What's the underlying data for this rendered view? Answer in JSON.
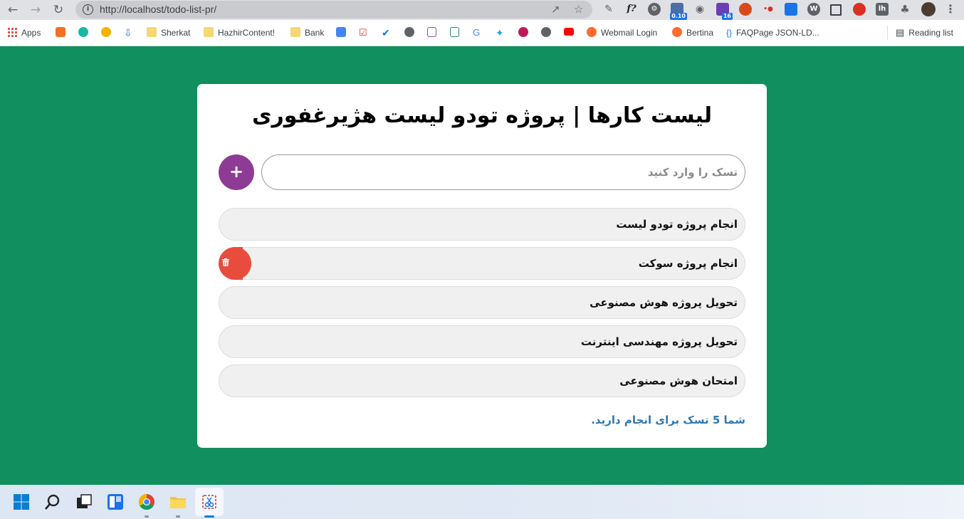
{
  "browser": {
    "url": "http://localhost/todo-list-pr/",
    "bookmarks": [
      {
        "label": "Apps"
      },
      {
        "label": "Sherkat"
      },
      {
        "label": "HazhirContent!"
      },
      {
        "label": "Bank"
      },
      {
        "label": "Webmail Login"
      },
      {
        "label": "Bertina"
      },
      {
        "label": "FAQPage JSON-LD..."
      }
    ],
    "reading_list": "Reading list",
    "extension_badges": {
      "ext_a": "0.10",
      "ext_b": "16"
    }
  },
  "app": {
    "title": "لیست کارها | پروژه تودو لیست هژیرغفوری",
    "input_placeholder": "تسک را وارد کنید",
    "add_button": "+",
    "tasks": [
      {
        "label": "انجام پروژه تودو لیست"
      },
      {
        "label": "انجام پروژه سوکت"
      },
      {
        "label": "تحویل پروژه هوش مصنوعی"
      },
      {
        "label": "تحویل پروژه مهندسی اینترنت"
      },
      {
        "label": "امتحان هوش مصنوعی"
      }
    ],
    "summary": "شما 5 تسک برای انجام دارید."
  },
  "colors": {
    "page_bg": "#118f5e",
    "card_bg": "#ffffff",
    "add_button": "#8e3b95",
    "delete_button": "#e74c3c",
    "summary_text": "#2f78b0"
  }
}
